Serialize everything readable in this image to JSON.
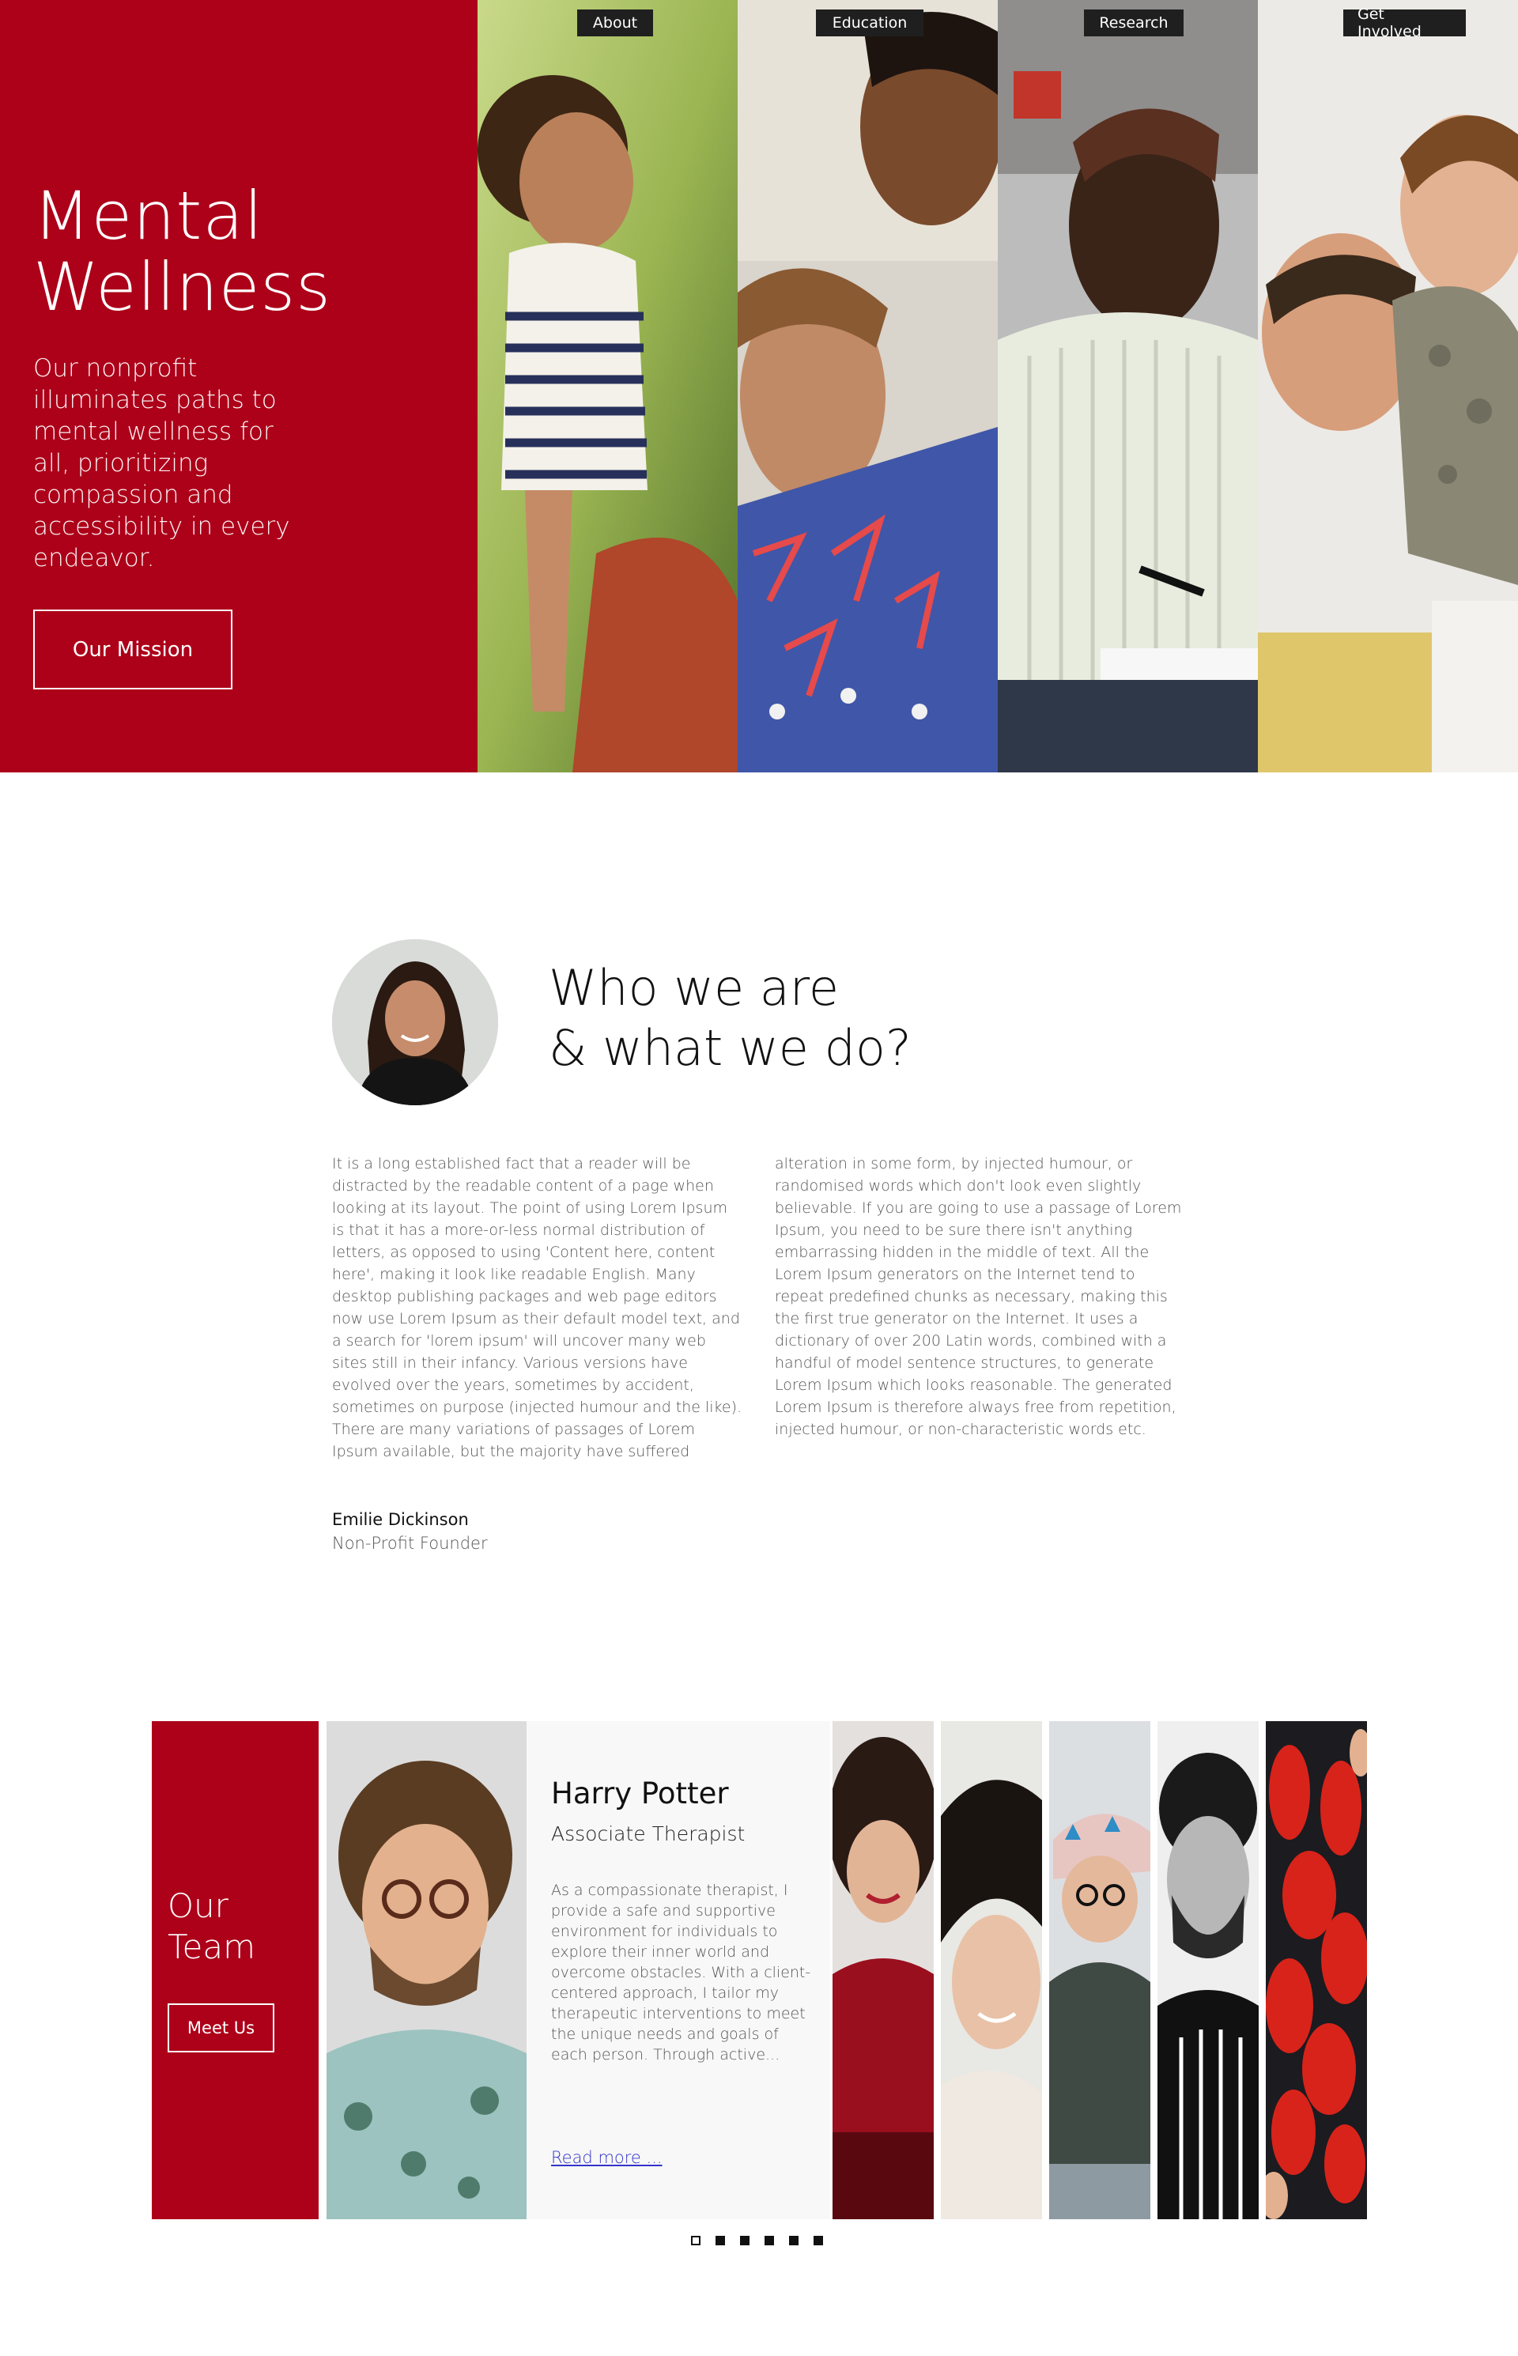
{
  "hero": {
    "title_line1": "Mental",
    "title_line2": "Wellness",
    "subtitle": "Our nonprofit illuminates paths to mental wellness for all, prioritizing compassion and accessibility in every endeavor.",
    "cta_label": "Our Mission",
    "accent_color": "#ad0019"
  },
  "nav": {
    "items": [
      {
        "label": "About"
      },
      {
        "label": "Education"
      },
      {
        "label": "Research"
      },
      {
        "label": "Get Involved"
      }
    ]
  },
  "about": {
    "title_line1": "Who we are",
    "title_line2": "& what we do?",
    "col1": "It is a long established fact that a reader will be distracted by the readable content of a page when looking at its layout. The point of using Lorem Ipsum is that it has a more-or-less normal distribution of letters, as opposed to using 'Content here, content here', making it look like readable English. Many desktop publishing packages and web page editors now use Lorem Ipsum as their default model text, and a search for 'lorem ipsum' will uncover many web sites still in their infancy. Various versions have evolved over the years, sometimes by accident, sometimes on purpose (injected humour and the like). There are many variations of passages of Lorem Ipsum available, but the majority have suffered",
    "col2": "alteration in some form, by injected humour, or randomised words which don't look even slightly believable. If you are going to use a passage of Lorem Ipsum, you need to be sure there isn't anything embarrassing hidden in the middle of text. All the Lorem Ipsum generators on the Internet tend to repeat predefined chunks as necessary, making this the first true generator on the Internet. It uses a dictionary of over 200 Latin words, combined with a handful of model sentence structures, to generate Lorem Ipsum which looks reasonable. The generated Lorem Ipsum is therefore always free from repetition, injected humour, or non-characteristic words etc.",
    "founder_name": "Emilie Dickinson",
    "founder_role": "Non-Profit Founder"
  },
  "team": {
    "title_line1": "Our",
    "title_line2": "Team",
    "cta_label": "Meet Us",
    "featured": {
      "name": "Harry Potter",
      "role": "Associate Therapist",
      "bio": "As a compassionate therapist, I provide a safe and supportive environment for individuals to explore their inner world and overcome obstacles. With a client-centered approach, I tailor my therapeutic interventions to meet the unique needs and goals of each person. Through active...",
      "link_label": "Read more ..."
    },
    "slide_count": 6,
    "active_slide": 1
  }
}
